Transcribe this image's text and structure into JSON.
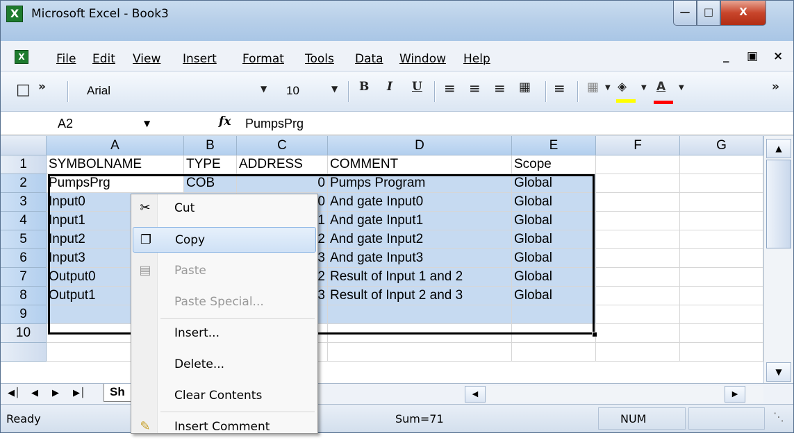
{
  "window": {
    "title": "Microsoft Excel - Book3",
    "app_icon": "excel-icon"
  },
  "menubar": {
    "items": [
      "File",
      "Edit",
      "View",
      "Insert",
      "Format",
      "Tools",
      "Data",
      "Window",
      "Help"
    ]
  },
  "toolbar": {
    "font": "Arial",
    "font_size": "10",
    "bold": "B",
    "italic": "I",
    "underline": "U",
    "font_color": "A",
    "highlight_color": "#ffff00",
    "text_color": "#ff0000"
  },
  "formula_bar": {
    "name_box": "A2",
    "fx": "fx",
    "content": "PumpsPrg"
  },
  "columns": [
    "A",
    "B",
    "C",
    "D",
    "E",
    "F",
    "G"
  ],
  "rows": [
    {
      "n": "1",
      "a": "SYMBOLNAME",
      "b": "TYPE",
      "c": "ADDRESS",
      "d": "COMMENT",
      "e": "Scope"
    },
    {
      "n": "2",
      "a": "PumpsPrg",
      "b": "COB",
      "c": "0",
      "d": "Pumps Program",
      "e": "Global"
    },
    {
      "n": "3",
      "a": "Input0",
      "b": "",
      "c": "0",
      "d": "And gate Input0",
      "e": "Global"
    },
    {
      "n": "4",
      "a": "Input1",
      "b": "",
      "c": "1",
      "d": "And gate Input1",
      "e": "Global"
    },
    {
      "n": "5",
      "a": "Input2",
      "b": "",
      "c": "2",
      "d": "And gate Input2",
      "e": "Global"
    },
    {
      "n": "6",
      "a": "Input3",
      "b": "",
      "c": "3",
      "d": "And gate Input3",
      "e": "Global"
    },
    {
      "n": "7",
      "a": "Output0",
      "b": "",
      "c": "2",
      "d": "Result of Input 1 and 2",
      "e": "Global"
    },
    {
      "n": "8",
      "a": "Output1",
      "b": "",
      "c": "3",
      "d": "Result of Input 2 and 3",
      "e": "Global"
    },
    {
      "n": "9",
      "a": "",
      "b": "",
      "c": "",
      "d": "",
      "e": ""
    },
    {
      "n": "10",
      "a": "",
      "b": "",
      "c": "",
      "d": "",
      "e": ""
    }
  ],
  "sheet_tab": "Sh",
  "status": {
    "ready": "Ready",
    "sum": "Sum=71",
    "num": "NUM"
  },
  "context_menu": {
    "items": [
      {
        "label": "Cut",
        "icon": "scissors-icon",
        "enabled": true
      },
      {
        "label": "Copy",
        "icon": "copy-icon",
        "enabled": true,
        "highlighted": true
      },
      {
        "label": "Paste",
        "icon": "paste-icon",
        "enabled": false
      },
      {
        "label": "Paste Special...",
        "enabled": false
      },
      {
        "label": "Insert...",
        "enabled": true
      },
      {
        "label": "Delete...",
        "enabled": true
      },
      {
        "label": "Clear Contents",
        "enabled": true
      },
      {
        "label": "Insert Comment",
        "icon": "comment-icon",
        "enabled": true
      }
    ]
  }
}
